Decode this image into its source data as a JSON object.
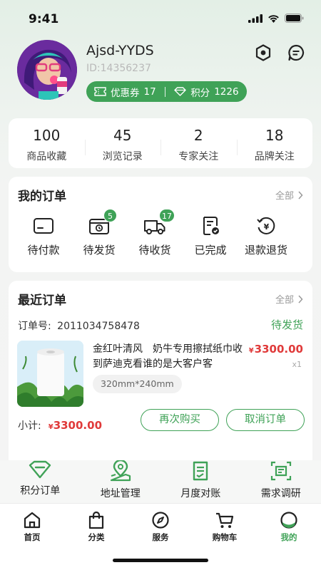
{
  "status_bar": {
    "time": "9:41"
  },
  "profile": {
    "username": "Ajsd-YYDS",
    "user_id": "ID:14356237",
    "coupons_label": "优惠券",
    "coupons_count": "17",
    "points_label": "积分",
    "points_count": "1226"
  },
  "stats": [
    {
      "num": "100",
      "label": "商品收藏"
    },
    {
      "num": "45",
      "label": "浏览记录"
    },
    {
      "num": "2",
      "label": "专家关注"
    },
    {
      "num": "18",
      "label": "品牌关注"
    }
  ],
  "my_orders": {
    "title": "我的订单",
    "more": "全部",
    "items": [
      {
        "label": "待付款",
        "badge": ""
      },
      {
        "label": "待发货",
        "badge": "5"
      },
      {
        "label": "待收货",
        "badge": "17"
      },
      {
        "label": "已完成",
        "badge": ""
      },
      {
        "label": "退款退货",
        "badge": ""
      }
    ]
  },
  "recent_orders": {
    "title": "最近订单",
    "more": "全部",
    "order_no_label": "订单号:",
    "order_no": "2011034758478",
    "status": "待发货",
    "product_name": "金红叶清风　奶牛专用擦拭纸巾收到萨迪克看谁的是大客户客",
    "currency": "¥",
    "price": "3300.00",
    "qty": "x1",
    "spec": "320mm*240mm",
    "subtotal_label": "小计:",
    "subtotal": "3300.00",
    "rebuy_label": "再次购买",
    "cancel_label": "取消订单"
  },
  "services": [
    {
      "label": "积分订单"
    },
    {
      "label": "地址管理"
    },
    {
      "label": "月度对账"
    },
    {
      "label": "需求调研"
    }
  ],
  "tabbar": [
    {
      "label": "首页"
    },
    {
      "label": "分类"
    },
    {
      "label": "服务"
    },
    {
      "label": "购物车"
    },
    {
      "label": "我的"
    }
  ],
  "colors": {
    "accent": "#3fa257",
    "price": "#e03a3a"
  }
}
